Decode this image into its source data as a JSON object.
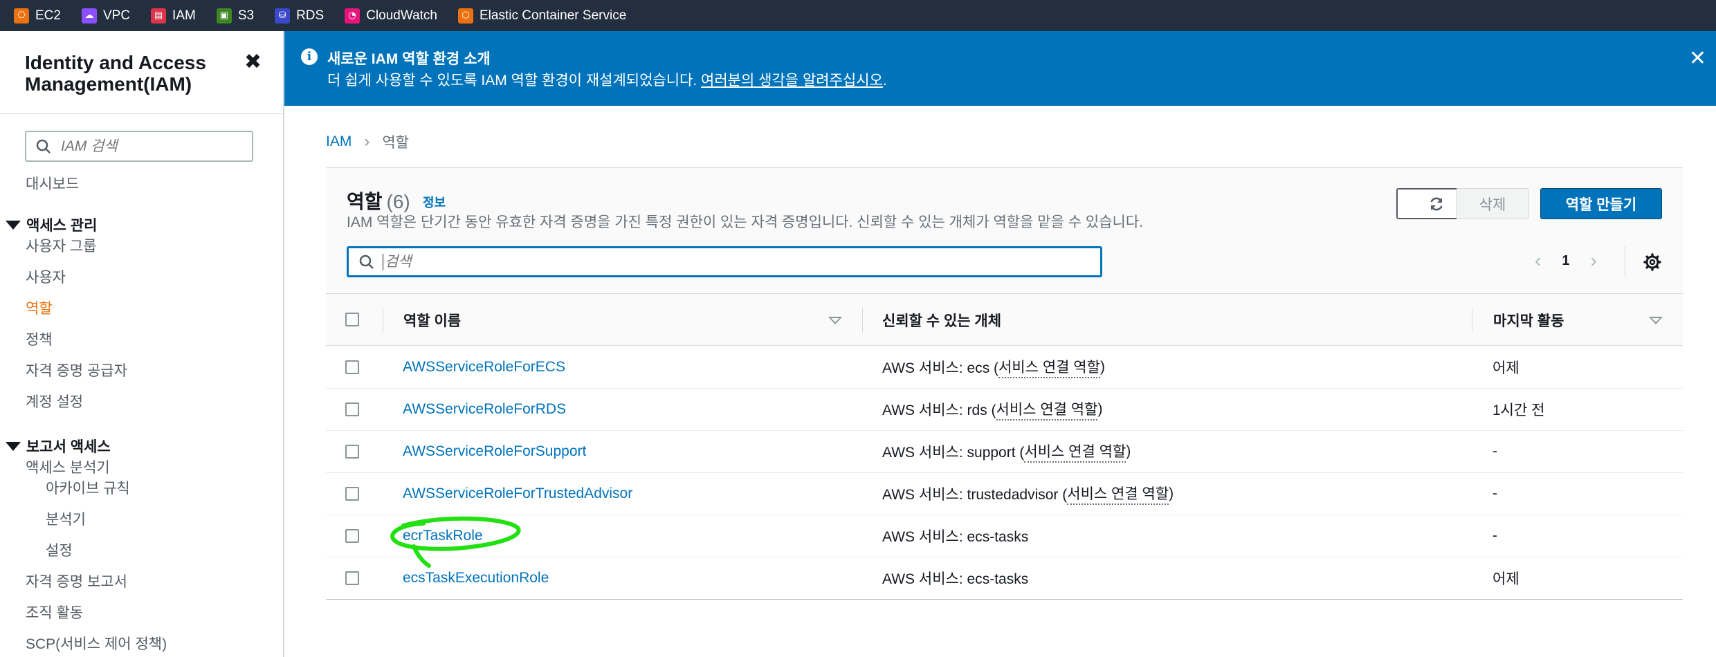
{
  "favorites": [
    {
      "label": "EC2",
      "icon": "ec2-icon",
      "color": "#ec7211",
      "glyph": "⎔"
    },
    {
      "label": "VPC",
      "icon": "vpc-icon",
      "color": "#8c4fff",
      "glyph": "☁"
    },
    {
      "label": "IAM",
      "icon": "iam-icon",
      "color": "#dd344c",
      "glyph": "▤"
    },
    {
      "label": "S3",
      "icon": "s3-icon",
      "color": "#3f8624",
      "glyph": "▣"
    },
    {
      "label": "RDS",
      "icon": "rds-icon",
      "color": "#3b48cc",
      "glyph": "⛁"
    },
    {
      "label": "CloudWatch",
      "icon": "cloudwatch-icon",
      "color": "#e7157b",
      "glyph": "◔"
    },
    {
      "label": "Elastic Container Service",
      "icon": "ecs-icon",
      "color": "#ec7211",
      "glyph": "⬡"
    }
  ],
  "sidebar": {
    "title": "Identity and Access Management(IAM)",
    "search_placeholder": "IAM 검색",
    "dashboard": "대시보드",
    "access_management": {
      "label": "액세스 관리",
      "items": [
        "사용자 그룹",
        "사용자",
        "역할",
        "정책",
        "자격 증명 공급자",
        "계정 설정"
      ],
      "active": "역할"
    },
    "access_reports": {
      "label": "보고서 액세스",
      "analyzer": "액세스 분석기",
      "analyzer_items": [
        "아카이브 규칙",
        "분석기",
        "설정"
      ],
      "items": [
        "자격 증명 보고서",
        "조직 활동",
        "SCP(서비스 제어 정책)"
      ]
    }
  },
  "banner": {
    "title": "새로운 IAM 역할 환경 소개",
    "text": "더 쉽게 사용할 수 있도록 IAM 역할 환경이 재설계되었습니다. ",
    "link": "여러분의 생각을 알려주십시오",
    "text_end": "."
  },
  "breadcrumb": {
    "root": "IAM",
    "current": "역할"
  },
  "roles": {
    "title": "역할",
    "count": "(6)",
    "info": "정보",
    "description": "IAM 역할은 단기간 동안 유효한 자격 증명을 가진 특정 권한이 있는 자격 증명입니다. 신뢰할 수 있는 개체가 역할을 맡을 수 있습니다.",
    "delete_label": "삭제",
    "create_label": "역할 만들기",
    "search_placeholder": "검색",
    "page": "1",
    "columns": {
      "name": "역할 이름",
      "trusted": "신뢰할 수 있는 개체",
      "last_activity": "마지막 활동"
    },
    "rows": [
      {
        "name": "AWSServiceRoleForECS",
        "trusted_prefix": "AWS 서비스: ecs (",
        "trusted_link": "서비스 연결 역할",
        "trusted_suffix": ")",
        "last": "어제"
      },
      {
        "name": "AWSServiceRoleForRDS",
        "trusted_prefix": "AWS 서비스: rds (",
        "trusted_link": "서비스 연결 역할",
        "trusted_suffix": ")",
        "last": "1시간 전"
      },
      {
        "name": "AWSServiceRoleForSupport",
        "trusted_prefix": "AWS 서비스: support (",
        "trusted_link": "서비스 연결 역할",
        "trusted_suffix": ")",
        "last": "-"
      },
      {
        "name": "AWSServiceRoleForTrustedAdvisor",
        "trusted_prefix": "AWS 서비스: trustedadvisor (",
        "trusted_link": "서비스 연결 역할",
        "trusted_suffix": ")",
        "last": "-"
      },
      {
        "name": "ecrTaskRole",
        "trusted_prefix": "AWS 서비스: ecs-tasks",
        "trusted_link": "",
        "trusted_suffix": "",
        "last": "-"
      },
      {
        "name": "ecsTaskExecutionRole",
        "trusted_prefix": "AWS 서비스: ecs-tasks",
        "trusted_link": "",
        "trusted_suffix": "",
        "last": "어제"
      }
    ]
  },
  "annotation_color": "#22e012"
}
